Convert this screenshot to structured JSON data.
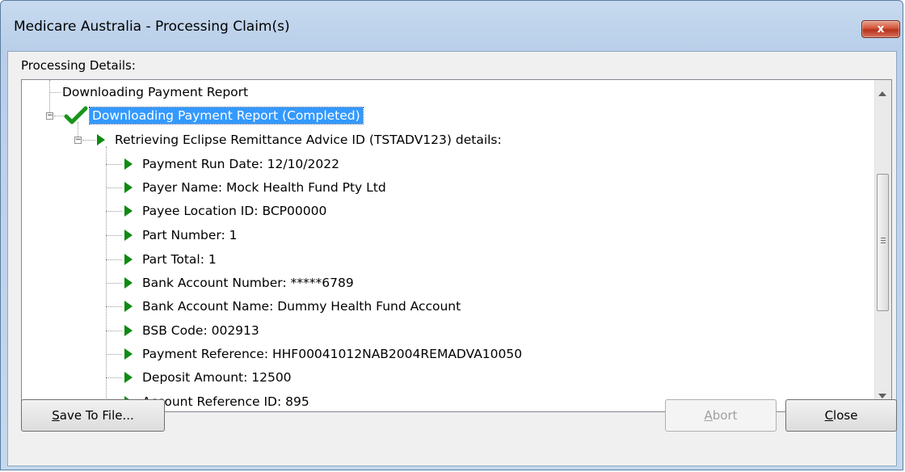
{
  "window": {
    "title": "Medicare Australia - Processing Claim(s)",
    "close_glyph": "x"
  },
  "group_label": "Processing Details:",
  "tree": {
    "root_item": "Downloading Payment Report",
    "completed_item": "Downloading Payment Report (Completed)",
    "retrieving_item": "Retrieving Eclipse Remittance Advice ID (TSTADV123) details:",
    "details": [
      "Payment Run Date: 12/10/2022",
      "Payer Name: Mock Health Fund Pty Ltd",
      "Payee Location ID: BCP00000",
      "Part Number: 1",
      "Part Total: 1",
      "Bank Account Number: *****6789",
      "Bank Account Name: Dummy Health Fund Account",
      "BSB Code: 002913",
      "Payment Reference: HHF00041012NAB2004REMADVA10050",
      "Deposit Amount: 12500",
      "Account Reference ID: 895"
    ]
  },
  "buttons": {
    "save": {
      "mnemonic": "S",
      "rest": "ave To File..."
    },
    "abort": {
      "mnemonic": "A",
      "rest": "bort"
    },
    "close": {
      "mnemonic": "C",
      "rest": "lose"
    }
  },
  "colors": {
    "highlight": "#3399ff",
    "tree_icon_green": "#0f8a12",
    "title_bar": "#b9cfe9"
  },
  "icons": {
    "completed": "check-icon",
    "item": "play-triangle-icon"
  }
}
